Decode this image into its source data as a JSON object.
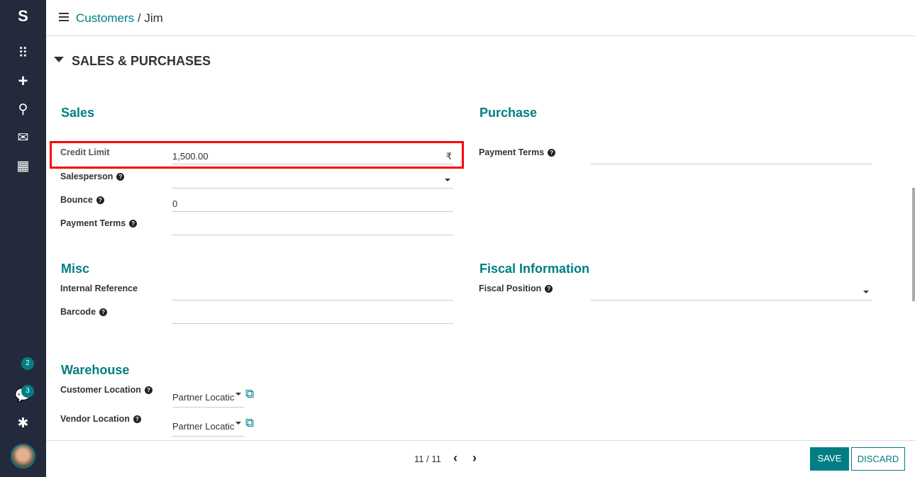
{
  "sidebar": {
    "logo": "S",
    "icons": [
      "apps-icon",
      "plus-icon",
      "search-icon",
      "mail-icon",
      "calendar-icon",
      "activity-icon",
      "chat-icon",
      "bug-icon"
    ],
    "activity_count": "2",
    "chat_count": "3"
  },
  "breadcrumb": {
    "parent": "Customers",
    "sep": "/",
    "current": "Jim"
  },
  "section": {
    "title": "SALES & PURCHASES"
  },
  "sales": {
    "title": "Sales",
    "credit_limit_label": "Credit Limit",
    "credit_limit_value": "1,500.00",
    "currency": "₹",
    "salesperson_label": "Salesperson",
    "salesperson_value": "",
    "bounce_label": "Bounce",
    "bounce_value": "0",
    "payment_terms_label": "Payment Terms",
    "payment_terms_value": ""
  },
  "purchase": {
    "title": "Purchase",
    "payment_terms_label": "Payment Terms",
    "payment_terms_value": ""
  },
  "misc": {
    "title": "Misc",
    "internal_ref_label": "Internal Reference",
    "internal_ref_value": "",
    "barcode_label": "Barcode",
    "barcode_value": ""
  },
  "fiscal": {
    "title": "Fiscal Information",
    "position_label": "Fiscal Position",
    "position_value": ""
  },
  "warehouse": {
    "title": "Warehouse",
    "customer_loc_label": "Customer Location",
    "customer_loc_value": "Partner Locatic",
    "vendor_loc_label": "Vendor Location",
    "vendor_loc_value": "Partner Locatic"
  },
  "footer": {
    "pager": "11 / 11",
    "prev": "‹",
    "next": "›",
    "save": "SAVE",
    "discard": "DISCARD"
  },
  "colors": {
    "accent": "#017e84",
    "sidebar": "#232a3c",
    "highlight": "#ff0000"
  }
}
